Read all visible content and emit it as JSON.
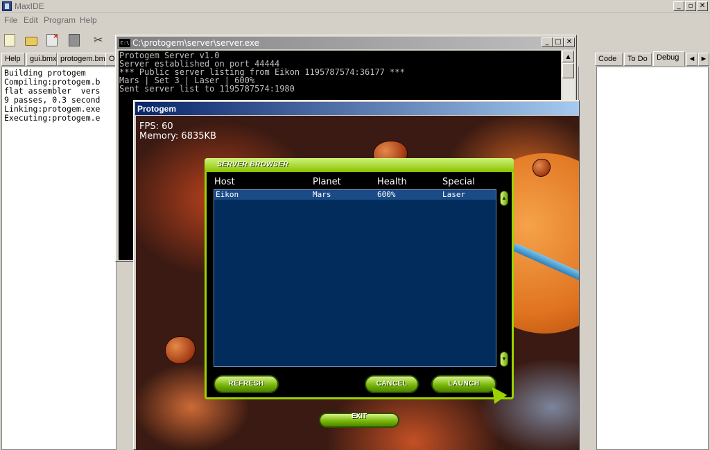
{
  "app": {
    "title": "MaxIDE",
    "menu": [
      "File",
      "Edit",
      "Program",
      "Help"
    ],
    "window_buttons": [
      "_",
      "▫",
      "✕"
    ]
  },
  "toolbar": {
    "icons": [
      "new-file-icon",
      "open-folder-icon",
      "close-file-icon",
      "save-icon",
      "cut-icon"
    ]
  },
  "left_panel": {
    "tabs": [
      "Help",
      "gui.bmx",
      "protogem.bmx",
      "Ou"
    ],
    "output_lines": [
      "Building protogem",
      "Compiling:protogem.b",
      "flat assembler  vers",
      "9 passes, 0.3 second",
      "Linking:protogem.exe",
      "Executing:protogem.e"
    ]
  },
  "right_panel": {
    "tabs": [
      "Code",
      "To Do",
      "Debug"
    ],
    "active_tab": "Debug",
    "arrows": [
      "◄",
      "►"
    ]
  },
  "console": {
    "title": "C:\\protogem\\server\\server.exe",
    "icon_text": "C:\\",
    "lines": [
      "Protogem Server v1.0",
      "Server established on port 44444",
      "*** Public server listing from Eikon 1195787574:36177 ***",
      "Mars | Set 3 | Laser | 600%",
      "Sent server list to 1195787574:1980"
    ]
  },
  "game": {
    "title": "Protogem",
    "fps": "FPS: 60",
    "memory": "Memory: 6835KB",
    "dialog": {
      "title": "SERVER BROWSER",
      "columns": [
        "Host",
        "Planet",
        "Health",
        "Special"
      ],
      "rows": [
        {
          "host": "Eikon",
          "planet": "Mars",
          "health": "600%",
          "special": "Laser"
        }
      ],
      "buttons": {
        "refresh": "REFRESH",
        "cancel": "CANCEL",
        "launch": "LAUNCH"
      }
    },
    "exit_label": "EXIT"
  },
  "colors": {
    "accent_green": "#9bd300",
    "list_bg": "#012c5c",
    "selected_row": "#1b4b86",
    "title_blue": "#0a246a"
  }
}
